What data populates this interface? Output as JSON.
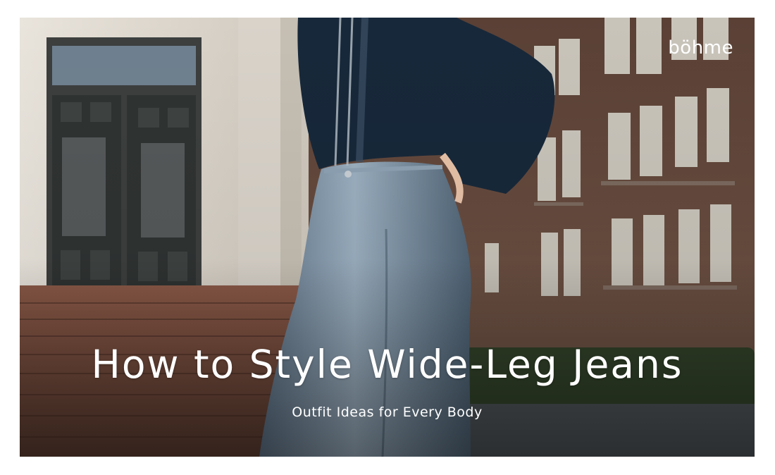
{
  "brand": {
    "logo_text": "böhme"
  },
  "hero": {
    "title": "How to Style Wide-Leg Jeans",
    "subtitle": "Outfit Ideas for Every Body"
  },
  "colors": {
    "brick": "#6b4b3b",
    "sweater": "#17283a",
    "denim": "#7f93a5",
    "stone": "#e7e2da",
    "hedge": "#33442a",
    "text": "#ffffff"
  }
}
